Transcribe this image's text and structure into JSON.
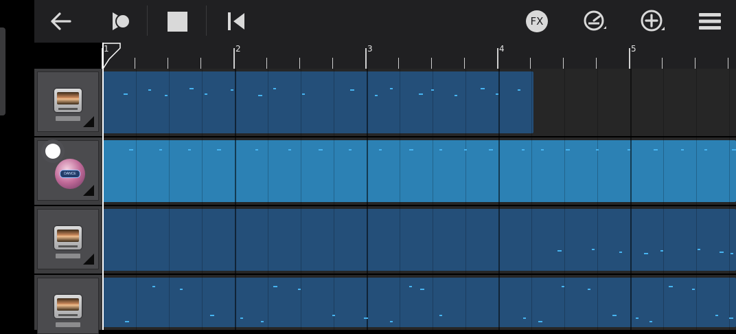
{
  "toolbar": {
    "fx_label": "FX",
    "buttons": [
      "back-icon",
      "play-icon",
      "stop-icon",
      "rewind-to-start-icon",
      "fx-icon",
      "metronome-icon",
      "add-icon",
      "menu-icon"
    ]
  },
  "ruler": {
    "bars": [
      "1",
      "2",
      "3",
      "4",
      "5"
    ]
  },
  "tracks": [
    {
      "name": "track-1",
      "icon": "amp-icon",
      "region_color": "#244f79",
      "region_end_fraction": 0.68
    },
    {
      "name": "track-2",
      "icon": "dance-icon",
      "dance_label": "DANCE",
      "region_color": "#2c81b4",
      "region_end_fraction": 1.0
    },
    {
      "name": "track-3",
      "icon": "amp-icon",
      "region_color": "#244f79",
      "region_end_fraction": 1.0
    },
    {
      "name": "track-4",
      "icon": "amp-icon",
      "region_color": "#244f79",
      "region_end_fraction": 1.0
    }
  ],
  "colors": {
    "toolbar_bg": "#202022",
    "note": "#47b4f0",
    "region_dark": "#244f79",
    "region_light": "#2c81b4"
  }
}
